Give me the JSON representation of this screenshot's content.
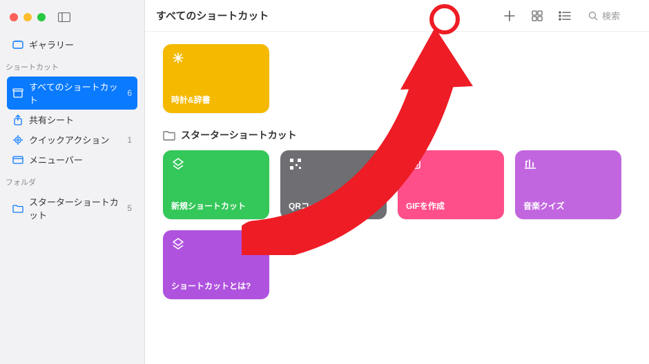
{
  "sidebar": {
    "gallery_label": "ギャラリー",
    "section1_heading": "ショートカット",
    "items1": [
      {
        "label": "すべてのショートカット",
        "count": "6"
      },
      {
        "label": "共有シート",
        "count": ""
      },
      {
        "label": "クイックアクション",
        "count": "1"
      },
      {
        "label": "メニューバー",
        "count": ""
      }
    ],
    "section2_heading": "フォルダ",
    "items2": [
      {
        "label": "スターターショートカット",
        "count": "5"
      }
    ]
  },
  "toolbar": {
    "title": "すべてのショートカット",
    "search_placeholder": "検索"
  },
  "main": {
    "top_card": {
      "label": "時計&辞書",
      "color": "#f5b900"
    },
    "folder_title": "スターターショートカット",
    "cards": [
      {
        "label": "新規ショートカット",
        "color": "#34c759"
      },
      {
        "label": "QRコードを作成する",
        "color": "#6e6e73"
      },
      {
        "label": "GIFを作成",
        "color": "#ff4f8b"
      },
      {
        "label": "音楽クイズ",
        "color": "#c266e0"
      },
      {
        "label": "ショートカットとは?",
        "color": "#af52de"
      }
    ]
  }
}
